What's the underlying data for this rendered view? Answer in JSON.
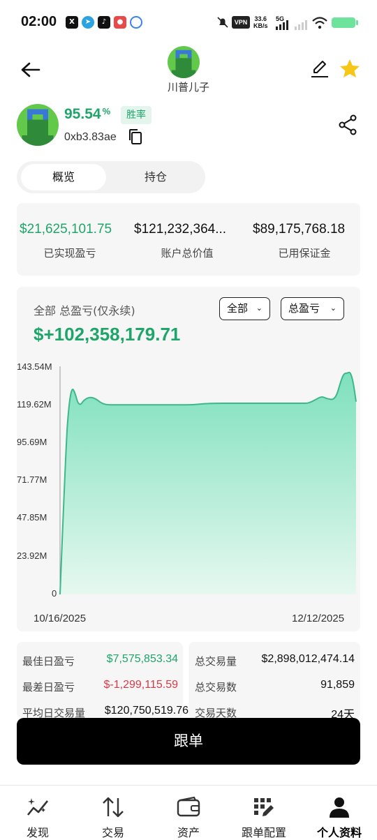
{
  "status_bar": {
    "time": "02:00",
    "vpn": "VPN",
    "net_speed_value": "33.6",
    "net_speed_unit": "KB/s",
    "network": "5G",
    "app_icons": [
      "x-icon",
      "telegram-icon",
      "tiktok-icon",
      "game-icon",
      "app-icon"
    ]
  },
  "header": {
    "username": "川普儿子",
    "win_rate_value": "95.54",
    "win_rate_unit": "%",
    "win_rate_label": "胜率",
    "address": "0xb3.83ae"
  },
  "tabs": [
    {
      "label": "概览",
      "active": true
    },
    {
      "label": "持仓",
      "active": false
    }
  ],
  "stats": [
    {
      "value": "$21,625,101.75",
      "label": "已实现盈亏",
      "color": "#1fa56a"
    },
    {
      "value": "$121,232,364...",
      "label": "账户总价值",
      "color": "#111111"
    },
    {
      "value": "$89,175,768.18",
      "label": "已用保证金",
      "color": "#111111"
    }
  ],
  "chart": {
    "subtitle": "全部 总盈亏(仅永续)",
    "total": "$+102,358,179.71",
    "filter_scope": "全部",
    "filter_metric": "总盈亏"
  },
  "chart_data": {
    "type": "area",
    "title": "全部 总盈亏(仅永续)",
    "ylabel": "",
    "xlabel": "",
    "ylim": [
      0,
      143.54
    ],
    "y_unit": "M",
    "y_ticks": [
      "143.54M",
      "119.62M",
      "95.69M",
      "71.77M",
      "47.85M",
      "23.92M",
      "0"
    ],
    "x_ticks": [
      "10/16/2025",
      "12/12/2025"
    ],
    "grid": false,
    "color": "#4fd1a0",
    "series": [
      {
        "x": [
          0,
          0.02,
          0.03,
          0.04,
          0.05,
          0.06,
          0.07,
          0.08,
          0.1,
          0.12,
          0.14,
          0.16,
          0.2,
          0.3,
          0.4,
          0.45,
          0.5,
          0.6,
          0.7,
          0.75,
          0.8,
          0.82,
          0.84,
          0.87,
          0.88,
          0.89,
          0.9,
          0.93,
          0.95,
          0.96,
          0.97,
          0.98,
          0.99,
          1.0
        ],
        "values": [
          0,
          95,
          120,
          131,
          128,
          121,
          120,
          123,
          125,
          124,
          121,
          120,
          120,
          120,
          120,
          120,
          121,
          121,
          121,
          121,
          121,
          121,
          121,
          124,
          125,
          125,
          124,
          123,
          136,
          140,
          140,
          141,
          135,
          122
        ]
      }
    ]
  },
  "summary": [
    {
      "label": "最佳日盈亏",
      "value": "$7,575,853.34",
      "color": "#1fa56a"
    },
    {
      "label": "最差日盈亏",
      "value": "$-1,299,115.59",
      "color": "#d93a4a"
    },
    {
      "label": "平均日交易量",
      "value": "$120,750,519.76",
      "color": "#111111"
    },
    {
      "label": "总交易量",
      "value": "$2,898,012,474.14",
      "color": "#111111"
    },
    {
      "label": "总交易数",
      "value": "91,859",
      "color": "#111111"
    },
    {
      "label": "交易天数",
      "value": "24天",
      "color": "#111111"
    }
  ],
  "follow_button": "跟单",
  "bottom_nav": [
    {
      "label": "发现",
      "icon": "discover-icon",
      "active": false
    },
    {
      "label": "交易",
      "icon": "trade-icon",
      "active": false
    },
    {
      "label": "资产",
      "icon": "wallet-icon",
      "active": false
    },
    {
      "label": "跟单配置",
      "icon": "copy-config-icon",
      "active": false
    },
    {
      "label": "个人资料",
      "icon": "profile-icon",
      "active": true
    }
  ]
}
